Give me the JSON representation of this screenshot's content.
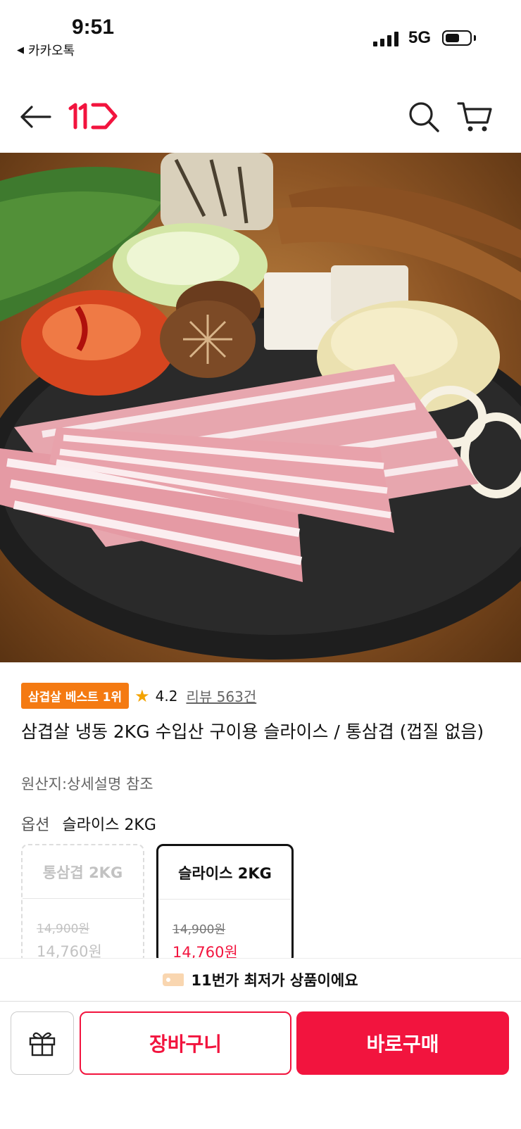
{
  "status_bar": {
    "time": "9:51",
    "back_app": "카카오톡",
    "network": "5G"
  },
  "header": {
    "logo": "11ST",
    "icons": [
      "back-arrow-icon",
      "search-icon",
      "cart-icon"
    ]
  },
  "hero": {
    "alt": "삼겹살 냉동 상품 이미지"
  },
  "product": {
    "badge": "삼겹살 베스트 1위",
    "rating": "4.2",
    "review": "리뷰 563건",
    "title": "삼겹살 냉동 2KG 수입산 구이용 슬라이스 / 통삼겹 (껍질 없음)",
    "origin": "원산지:상세설명 참조"
  },
  "option": {
    "label": "옵션",
    "selected": "슬라이스 2KG",
    "cards": [
      {
        "name": "통삼겹 2KG",
        "original_price": "14,900원",
        "price": "14,760원",
        "state": "disabled"
      },
      {
        "name": "슬라이스 2KG",
        "original_price": "14,900원",
        "price": "14,760원",
        "state": "selected"
      }
    ]
  },
  "banner": {
    "text": "11번가 최저가 상품이에요"
  },
  "actions": {
    "cart": "장바구니",
    "buy": "바로구매"
  },
  "colors": {
    "accent": "#f2143e",
    "badge": "#f47a12",
    "star": "#f4a300"
  }
}
